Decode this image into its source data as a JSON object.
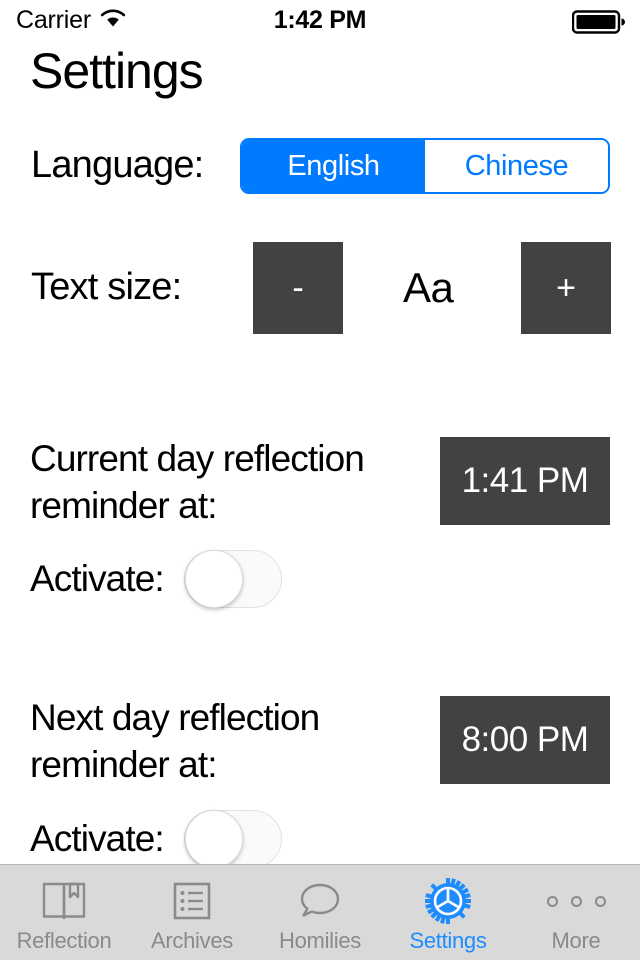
{
  "status_bar": {
    "carrier": "Carrier",
    "wifi_icon": "wifi-icon",
    "time": "1:42 PM",
    "battery_icon": "battery-full-icon"
  },
  "header": {
    "title": "Settings"
  },
  "language": {
    "label": "Language:",
    "options": [
      "English",
      "Chinese"
    ],
    "selected": "English"
  },
  "text_size": {
    "label": "Text size:",
    "decrease_label": "-",
    "sample_label": "Aa",
    "increase_label": "+"
  },
  "current_day_reminder": {
    "label": "Current day reflection reminder at:",
    "time": "1:41 PM",
    "activate_label": "Activate:",
    "activated": false
  },
  "next_day_reminder": {
    "label": "Next day reflection reminder at:",
    "time": "8:00 PM",
    "activate_label": "Activate:",
    "activated": false
  },
  "tab_bar": {
    "tabs": [
      {
        "label": "Reflection",
        "icon": "book-icon",
        "active": false
      },
      {
        "label": "Archives",
        "icon": "list-icon",
        "active": false
      },
      {
        "label": "Homilies",
        "icon": "speech-bubble-icon",
        "active": false
      },
      {
        "label": "Settings",
        "icon": "gear-icon",
        "active": true
      },
      {
        "label": "More",
        "icon": "ellipsis-icon",
        "active": false
      }
    ]
  },
  "colors": {
    "accent_blue": "#007AFF",
    "tab_active_blue": "#1E8CFF",
    "dark_button": "#424242",
    "tab_bar_background": "#D9D9D9",
    "tab_inactive": "#8A8A8A"
  }
}
